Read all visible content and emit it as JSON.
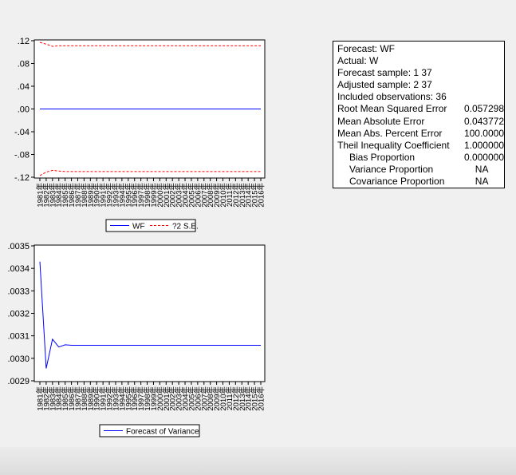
{
  "x_labels": [
    "1981年",
    "1982年",
    "1983年",
    "1984年",
    "1985年",
    "1986年",
    "1987年",
    "1988年",
    "1989年",
    "1990年",
    "1991年",
    "1992年",
    "1993年",
    "1994年",
    "1995年",
    "1996年",
    "1997年",
    "1998年",
    "1999年",
    "2000年",
    "2001年",
    "2002年",
    "2003年",
    "2004年",
    "2005年",
    "2006年",
    "2007年",
    "2008年",
    "2009年",
    "2010年",
    "2011年",
    "2012年",
    "2013年",
    "2014年",
    "2015年",
    "2016年"
  ],
  "chart_data": [
    {
      "type": "line",
      "title": "",
      "ylim": [
        -0.12,
        0.12
      ],
      "yticks": [
        ".12",
        ".08",
        ".04",
        ".00",
        "-.04",
        "-.08",
        "-.12"
      ],
      "ytick_values": [
        0.12,
        0.08,
        0.04,
        0.0,
        -0.04,
        -0.08,
        -0.12
      ],
      "legend": [
        "WF",
        "?2 S.E."
      ],
      "legend_placement": "bottom",
      "series": [
        {
          "name": "WF",
          "color": "#0000ff",
          "dash": false,
          "values": [
            0,
            0,
            0,
            0,
            0,
            0,
            0,
            0,
            0,
            0,
            0,
            0,
            0,
            0,
            0,
            0,
            0,
            0,
            0,
            0,
            0,
            0,
            0,
            0,
            0,
            0,
            0,
            0,
            0,
            0,
            0,
            0,
            0,
            0,
            0,
            0
          ]
        },
        {
          "name": "upper",
          "color": "#ff0000",
          "dash": true,
          "values": [
            0.117,
            0.114,
            0.11,
            0.111,
            0.111,
            0.111,
            0.111,
            0.111,
            0.111,
            0.111,
            0.111,
            0.111,
            0.111,
            0.111,
            0.111,
            0.111,
            0.111,
            0.111,
            0.111,
            0.111,
            0.111,
            0.111,
            0.111,
            0.111,
            0.111,
            0.111,
            0.111,
            0.111,
            0.111,
            0.111,
            0.111,
            0.111,
            0.111,
            0.111,
            0.111,
            0.111
          ]
        },
        {
          "name": "lower",
          "color": "#ff0000",
          "dash": true,
          "values": [
            -0.117,
            -0.111,
            -0.108,
            -0.109,
            -0.11,
            -0.11,
            -0.11,
            -0.11,
            -0.11,
            -0.11,
            -0.11,
            -0.11,
            -0.11,
            -0.11,
            -0.11,
            -0.11,
            -0.11,
            -0.11,
            -0.11,
            -0.11,
            -0.11,
            -0.11,
            -0.11,
            -0.11,
            -0.11,
            -0.11,
            -0.11,
            -0.11,
            -0.11,
            -0.11,
            -0.11,
            -0.11,
            -0.11,
            -0.11,
            -0.11,
            -0.11
          ]
        }
      ]
    },
    {
      "type": "line",
      "title": "",
      "ylim": [
        0.0029,
        0.0035
      ],
      "yticks": [
        ".0035",
        ".0034",
        ".0033",
        ".0032",
        ".0031",
        ".0030",
        ".0029"
      ],
      "ytick_values": [
        0.0035,
        0.0034,
        0.0033,
        0.0032,
        0.0031,
        0.003,
        0.0029
      ],
      "legend": [
        "Forecast of Variance"
      ],
      "legend_placement": "bottom",
      "series": [
        {
          "name": "Forecast of Variance",
          "color": "#0000ff",
          "dash": false,
          "values": [
            0.00343,
            0.002955,
            0.003085,
            0.00305,
            0.00306,
            0.003058,
            0.003058,
            0.003058,
            0.003058,
            0.003058,
            0.003058,
            0.003058,
            0.003058,
            0.003058,
            0.003058,
            0.003058,
            0.003058,
            0.003058,
            0.003058,
            0.003058,
            0.003058,
            0.003058,
            0.003058,
            0.003058,
            0.003058,
            0.003058,
            0.003058,
            0.003058,
            0.003058,
            0.003058,
            0.003058,
            0.003058,
            0.003058,
            0.003058,
            0.003058,
            0.003058
          ]
        }
      ]
    }
  ],
  "stats": {
    "forecast": "Forecast: WF",
    "actual": "Actual: W",
    "forecast_sample": "Forecast sample: 1 37",
    "adjusted_sample": "Adjusted sample: 2 37",
    "included": "Included observations: 36",
    "rows": [
      {
        "label": "Root Mean Squared Error",
        "value": "0.057298"
      },
      {
        "label": "Mean Absolute Error",
        "value": "0.043772"
      },
      {
        "label": "Mean Abs. Percent Error",
        "value": "100.0000"
      },
      {
        "label": "Theil Inequality Coefficient",
        "value": "1.000000"
      },
      {
        "label": "Bias Proportion",
        "value": "0.000000"
      },
      {
        "label": "Variance Proportion",
        "value": "NA"
      },
      {
        "label": "Covariance Proportion",
        "value": "NA"
      }
    ]
  }
}
